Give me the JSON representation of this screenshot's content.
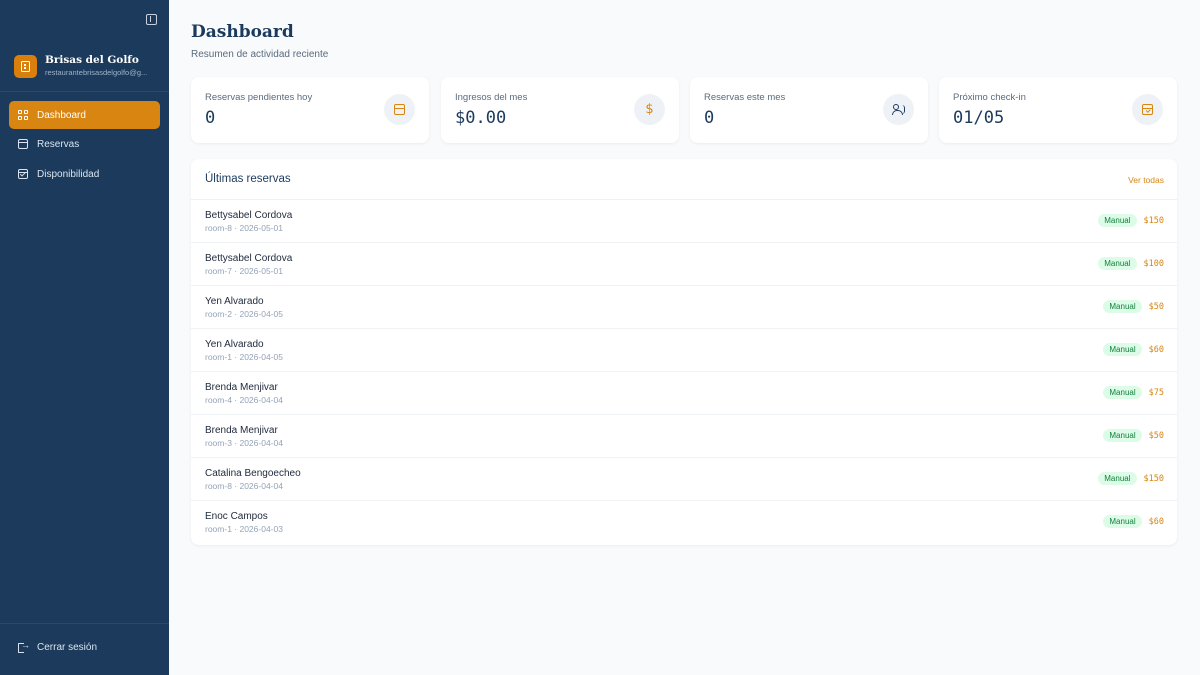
{
  "sidebar": {
    "brand_name": "Brisas del Golfo",
    "brand_email": "restaurantebrisasdelgolfo@g...",
    "nav": [
      {
        "label": "Dashboard",
        "icon": "grid-icon",
        "active": true
      },
      {
        "label": "Reservas",
        "icon": "calendar-icon",
        "active": false
      },
      {
        "label": "Disponibilidad",
        "icon": "calendar-check-icon",
        "active": false
      }
    ],
    "logout_label": "Cerrar sesión"
  },
  "header": {
    "title": "Dashboard",
    "subtitle": "Resumen de actividad reciente"
  },
  "stats": [
    {
      "label": "Reservas pendientes hoy",
      "value": "0",
      "icon": "calendar-icon"
    },
    {
      "label": "Ingresos del mes",
      "value": "$0.00",
      "icon": "dollar-icon"
    },
    {
      "label": "Reservas este mes",
      "value": "0",
      "icon": "users-icon"
    },
    {
      "label": "Próximo check-in",
      "value": "01/05",
      "icon": "calendar-check-icon"
    }
  ],
  "recent": {
    "title": "Últimas reservas",
    "view_all": "Ver todas",
    "rows": [
      {
        "name": "Bettysabel Cordova",
        "meta": "room-8 · 2026-05-01",
        "badge": "Manual",
        "price": "$150"
      },
      {
        "name": "Bettysabel Cordova",
        "meta": "room-7 · 2026-05-01",
        "badge": "Manual",
        "price": "$100"
      },
      {
        "name": "Yen Alvarado",
        "meta": "room-2 · 2026-04-05",
        "badge": "Manual",
        "price": "$50"
      },
      {
        "name": "Yen Alvarado",
        "meta": "room-1 · 2026-04-05",
        "badge": "Manual",
        "price": "$60"
      },
      {
        "name": "Brenda Menjivar",
        "meta": "room-4 · 2026-04-04",
        "badge": "Manual",
        "price": "$75"
      },
      {
        "name": "Brenda Menjivar",
        "meta": "room-3 · 2026-04-04",
        "badge": "Manual",
        "price": "$50"
      },
      {
        "name": "Catalina Bengoecheo",
        "meta": "room-8 · 2026-04-04",
        "badge": "Manual",
        "price": "$150"
      },
      {
        "name": "Enoc Campos",
        "meta": "room-1 · 2026-04-03",
        "badge": "Manual",
        "price": "$60"
      }
    ]
  },
  "colors": {
    "sidebar_bg": "#1b3a5c",
    "accent": "#d98512",
    "badge_bg": "#dcfce7",
    "badge_text": "#15803d"
  }
}
